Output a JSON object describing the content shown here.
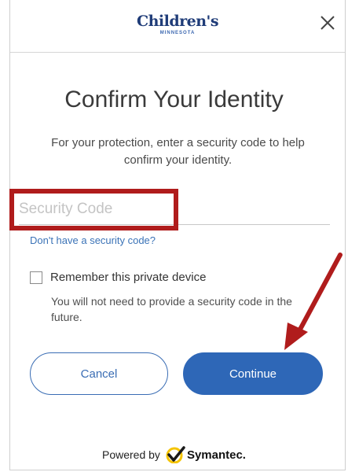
{
  "header": {
    "logo_name": "Children's",
    "logo_sub": "MINNESOTA",
    "close_icon": "close-icon"
  },
  "main": {
    "title": "Confirm Your Identity",
    "description": "For your protection, enter a security code to help confirm your identity.",
    "security_code": {
      "placeholder": "Security Code",
      "value": ""
    },
    "no_code_link": "Don't have a security code?",
    "remember": {
      "label": "Remember this private device",
      "help": "You will not need to provide a security code in the future.",
      "checked": false
    },
    "buttons": {
      "cancel": "Cancel",
      "continue": "Continue"
    }
  },
  "footer": {
    "powered_by": "Powered by",
    "brand": "Symantec."
  },
  "colors": {
    "brand_navy": "#1f3c78",
    "accent_blue": "#2e67b7",
    "link_blue": "#3b73b7",
    "annotation_red": "#b01c1c",
    "symantec_yellow": "#f5c400"
  }
}
